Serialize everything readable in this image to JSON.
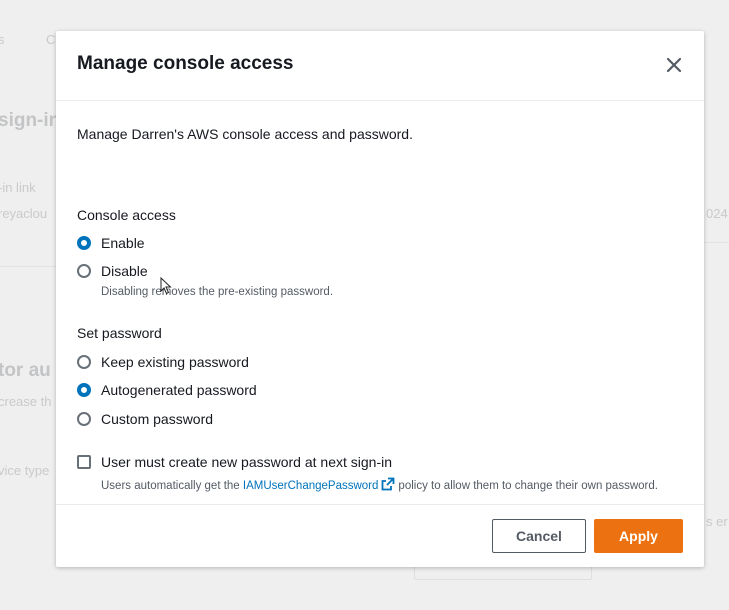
{
  "background": {
    "fragments": [
      "s",
      "C",
      "sign-in",
      "-in link",
      "reyaclou",
      "tor au",
      "crease th",
      "vice type",
      "024",
      "s er"
    ]
  },
  "modal": {
    "title": "Manage console access",
    "description": "Manage Darren's AWS console access and password.",
    "console_access": {
      "label": "Console access",
      "options": [
        {
          "label": "Enable",
          "checked": true
        },
        {
          "label": "Disable",
          "checked": false,
          "sublabel": "Disabling removes the pre-existing password."
        }
      ]
    },
    "set_password": {
      "label": "Set password",
      "options": [
        {
          "label": "Keep existing password",
          "checked": false
        },
        {
          "label": "Autogenerated password",
          "checked": true
        },
        {
          "label": "Custom password",
          "checked": false
        }
      ]
    },
    "require_reset": {
      "label": "User must create new password at next sign-in",
      "checked": false,
      "help_prefix": "Users automatically get the",
      "help_link": "IAMUserChangePassword",
      "help_suffix": "policy to allow them to change their own password."
    },
    "buttons": {
      "cancel": "Cancel",
      "apply": "Apply"
    }
  },
  "colors": {
    "accent": "#0073bb",
    "primary_button": "#ec7211"
  }
}
